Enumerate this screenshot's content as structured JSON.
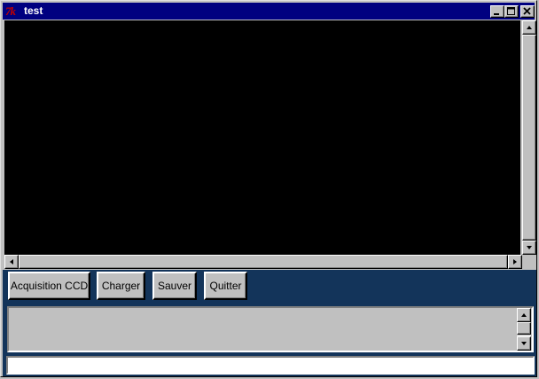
{
  "window": {
    "title": "test",
    "icon": "tk-icon",
    "controls": [
      "minimize-icon",
      "maximize-icon",
      "close-icon"
    ]
  },
  "toolbar": {
    "acquisition_label": "Acquisition CCD",
    "charger_label": "Charger",
    "sauver_label": "Sauver",
    "quitter_label": "Quitter"
  },
  "console": {
    "text": ""
  },
  "entry": {
    "value": ""
  },
  "colors": {
    "titlebar": "#000080",
    "panel": "#13345a",
    "canvas": "#000000",
    "face": "#c0c0c0"
  }
}
